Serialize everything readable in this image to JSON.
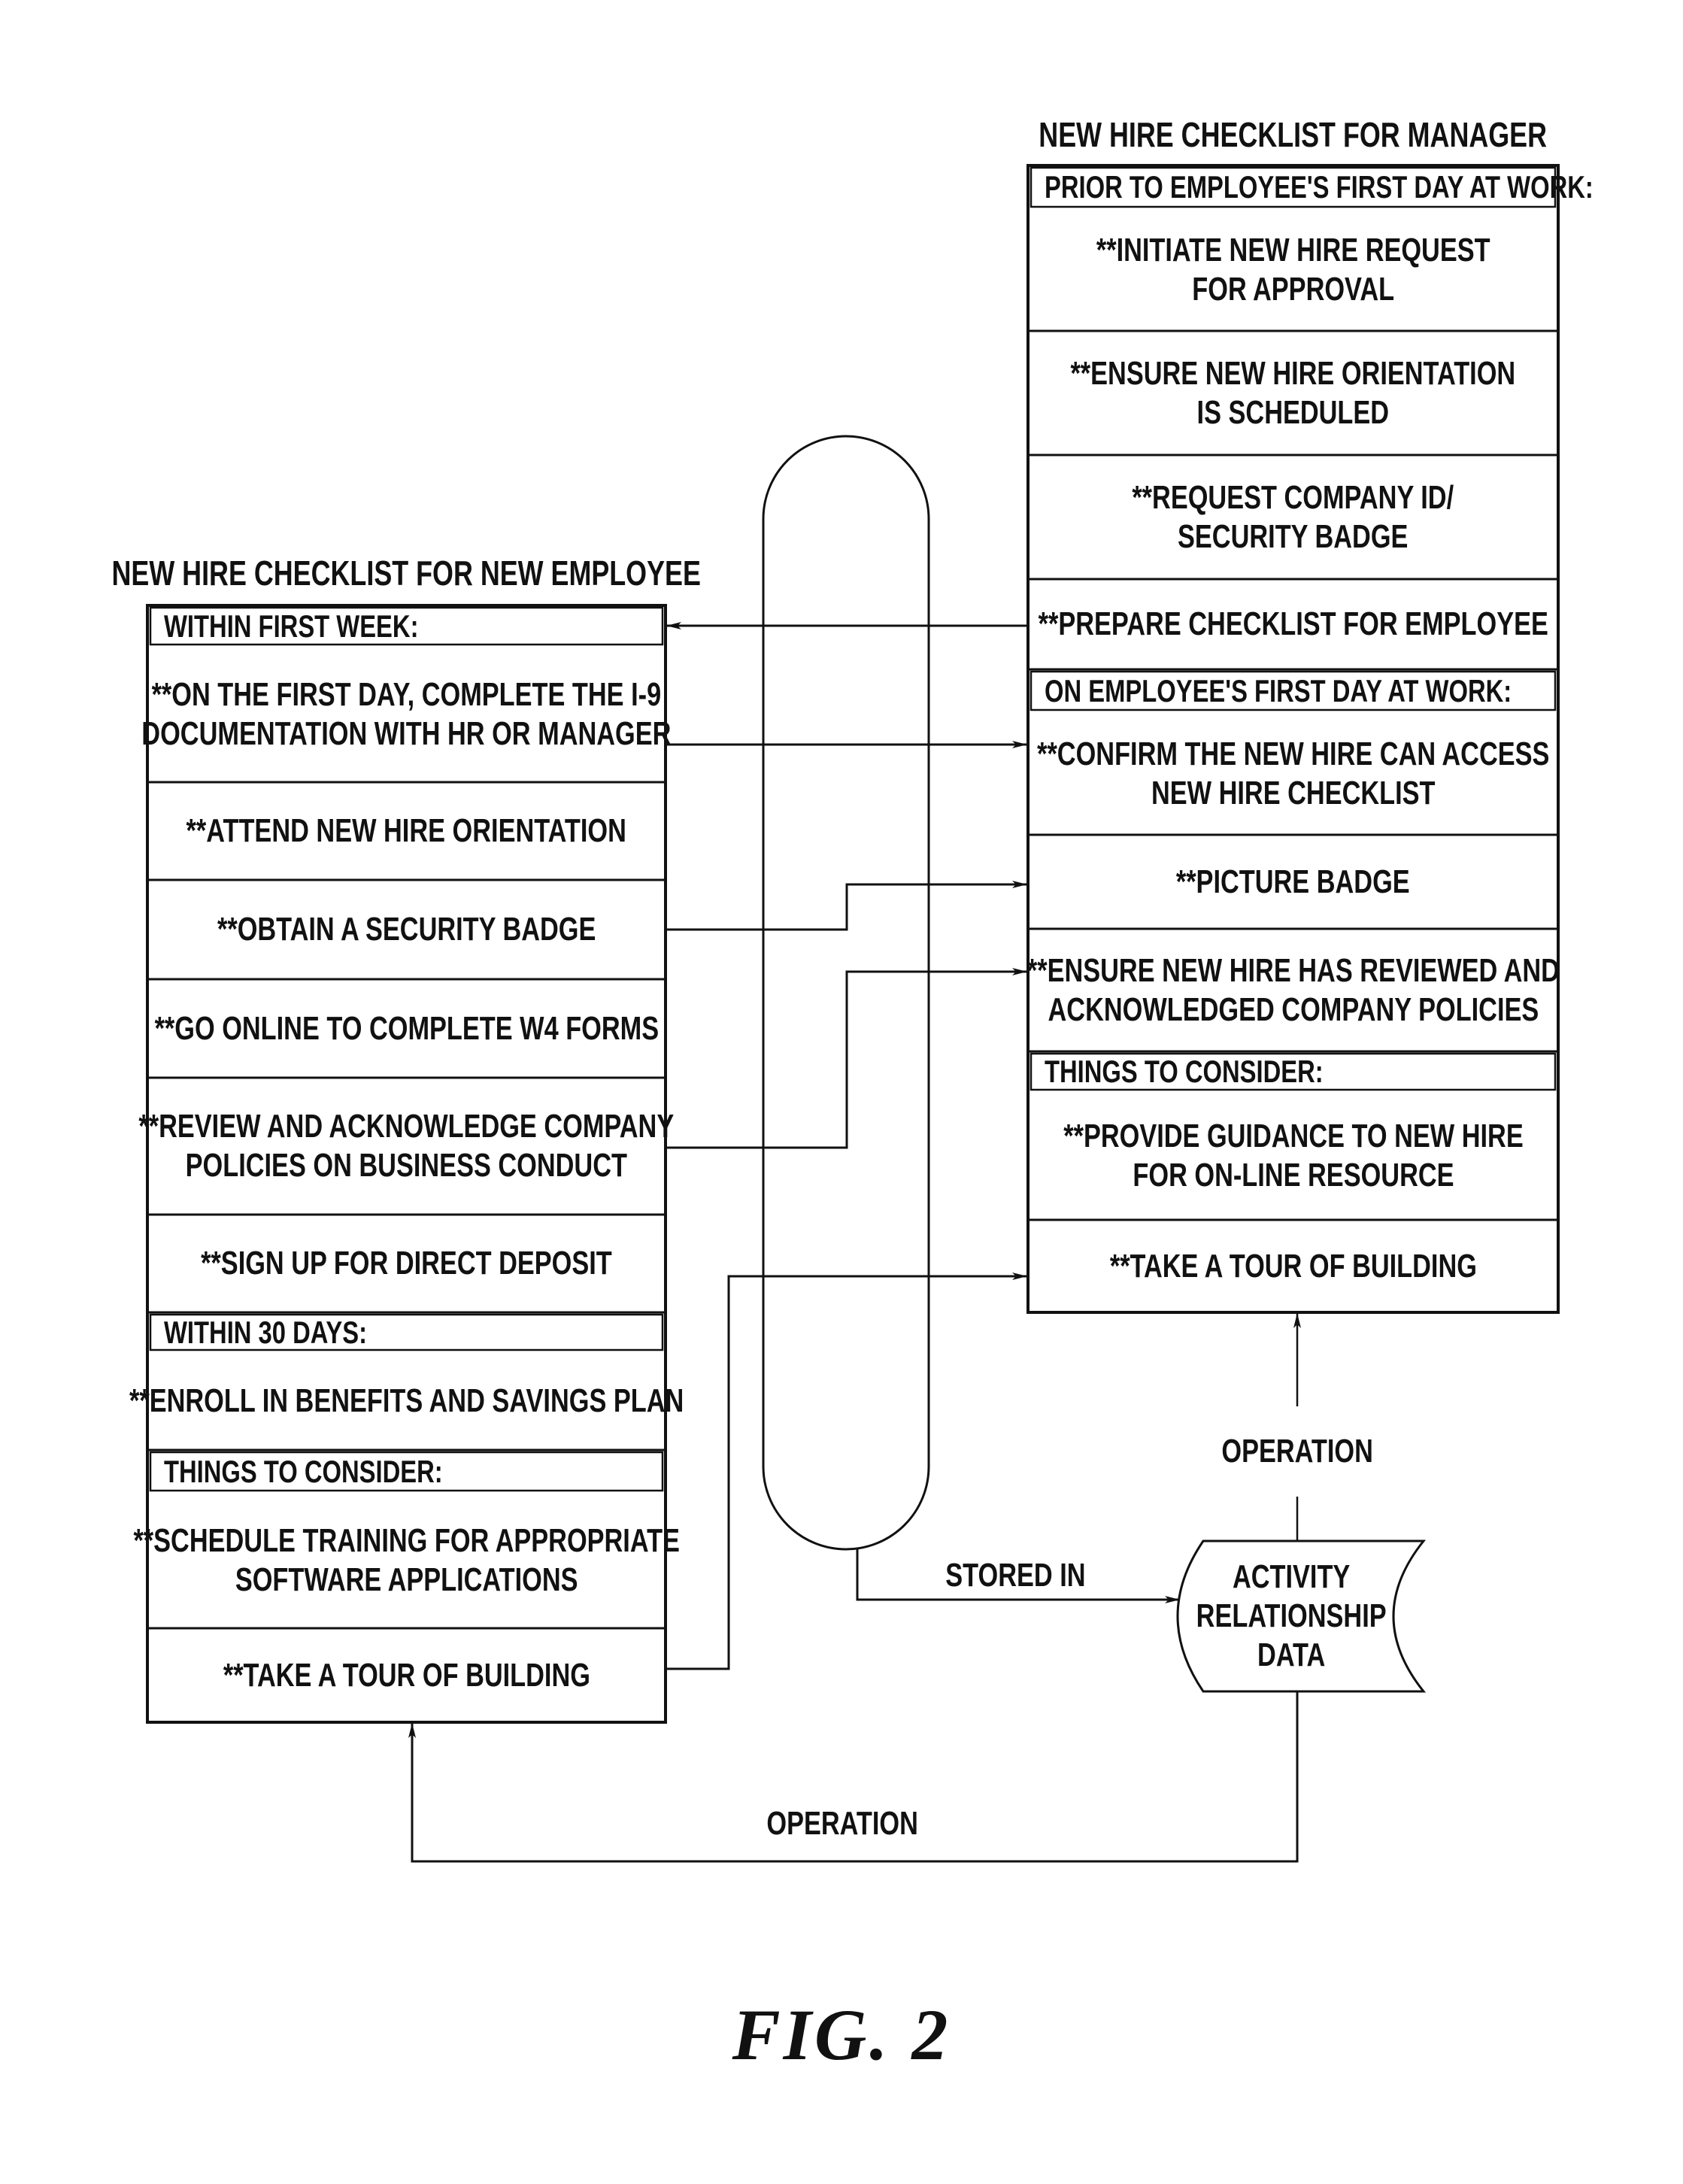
{
  "figure_label": "FIG.  2",
  "manager_checklist": {
    "title": "NEW HIRE CHECKLIST FOR MANAGER",
    "sections": [
      {
        "header": "PRIOR TO EMPLOYEE'S FIRST DAY AT WORK:",
        "items": [
          [
            "**INITIATE NEW HIRE REQUEST",
            "FOR APPROVAL"
          ],
          [
            "**ENSURE NEW HIRE ORIENTATION",
            "IS SCHEDULED"
          ],
          [
            "**REQUEST COMPANY ID/",
            "SECURITY BADGE"
          ],
          [
            "**PREPARE CHECKLIST FOR EMPLOYEE"
          ]
        ]
      },
      {
        "header": "ON EMPLOYEE'S FIRST DAY AT WORK:",
        "items": [
          [
            "**CONFIRM THE NEW HIRE CAN ACCESS",
            "NEW HIRE CHECKLIST"
          ],
          [
            "**PICTURE BADGE"
          ],
          [
            "**ENSURE NEW HIRE HAS REVIEWED AND",
            "ACKNOWLEDGED COMPANY POLICIES"
          ]
        ]
      },
      {
        "header": "THINGS TO CONSIDER:",
        "items": [
          [
            "**PROVIDE GUIDANCE TO NEW HIRE",
            "FOR ON-LINE RESOURCE"
          ],
          [
            "**TAKE A TOUR OF BUILDING"
          ]
        ]
      }
    ]
  },
  "employee_checklist": {
    "title": "NEW HIRE CHECKLIST FOR NEW EMPLOYEE",
    "sections": [
      {
        "header": "WITHIN FIRST WEEK:",
        "items": [
          [
            "**ON THE FIRST DAY, COMPLETE THE I-9",
            "DOCUMENTATION WITH HR OR MANAGER"
          ],
          [
            "**ATTEND NEW HIRE ORIENTATION"
          ],
          [
            "**OBTAIN A SECURITY BADGE"
          ],
          [
            "**GO ONLINE TO COMPLETE W4 FORMS"
          ],
          [
            "**REVIEW AND ACKNOWLEDGE COMPANY",
            "POLICIES ON BUSINESS CONDUCT"
          ],
          [
            "**SIGN UP FOR DIRECT DEPOSIT"
          ]
        ]
      },
      {
        "header": "WITHIN 30 DAYS:",
        "items": [
          [
            "**ENROLL IN BENEFITS AND SAVINGS PLAN"
          ]
        ]
      },
      {
        "header": "THINGS TO CONSIDER:",
        "items": [
          [
            "**SCHEDULE TRAINING FOR APPROPRIATE",
            "SOFTWARE APPLICATIONS"
          ],
          [
            "**TAKE A TOUR OF BUILDING"
          ]
        ]
      }
    ]
  },
  "storage": {
    "label_lines": [
      "ACTIVITY",
      "RELATIONSHIP",
      "DATA"
    ]
  },
  "connector_labels": {
    "stored_in": "STORED IN",
    "operation_to_manager": "OPERATION",
    "operation_to_employee": "OPERATION"
  },
  "relationships": [
    {
      "from": "manager: **PREPARE CHECKLIST FOR EMPLOYEE",
      "to": "employee: WITHIN FIRST WEEK:"
    },
    {
      "from": "employee: **ON THE FIRST DAY, COMPLETE THE I-9 DOCUMENTATION WITH HR OR MANAGER",
      "to": "manager: **CONFIRM THE NEW HIRE CAN ACCESS NEW HIRE CHECKLIST"
    },
    {
      "from": "employee: **OBTAIN A SECURITY BADGE",
      "to": "manager: **PICTURE BADGE"
    },
    {
      "from": "employee: **REVIEW AND ACKNOWLEDGE COMPANY POLICIES ON BUSINESS CONDUCT",
      "to": "manager: **ENSURE NEW HIRE HAS REVIEWED AND ACKNOWLEDGED COMPANY POLICIES"
    },
    {
      "from": "employee: **TAKE A TOUR OF BUILDING",
      "to": "manager: **TAKE A TOUR OF BUILDING"
    }
  ]
}
